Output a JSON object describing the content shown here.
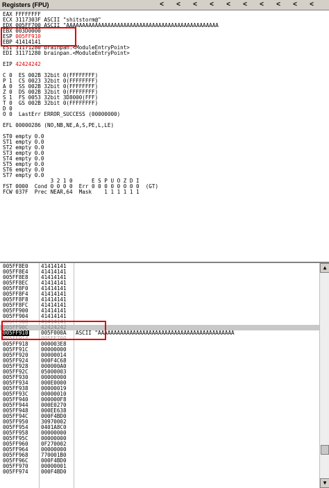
{
  "window": {
    "title": "Registers (FPU)",
    "nav_arrows": [
      "<",
      "<",
      "<",
      "<",
      "<",
      "<",
      "<",
      "<",
      "<",
      "<"
    ]
  },
  "registers": [
    {
      "text": "EAX FFFFFFFF"
    },
    {
      "text": "ECX 3117303F ASCII \"shitstorm@\""
    },
    {
      "text": "EDX 005FF700 ASCII \"AAAAAAAAAAAAAAAAAAAAAAAAAAAAAAAAAAAAAAAAAAAAAAAA"
    },
    {
      "text": "EBX 003D0000"
    },
    {
      "name": "ESP",
      "value": "005FF910"
    },
    {
      "text": "EBP 41414141"
    },
    {
      "text": "ESI 31171280 brainpan.<ModuleEntryPoint>"
    },
    {
      "text": "EDI 31171280 brainpan.<ModuleEntryPoint>"
    },
    {
      "blank": true
    },
    {
      "name": "EIP",
      "value": "42424242"
    },
    {
      "blank": true
    },
    {
      "text": "C 0  ES 002B 32bit 0(FFFFFFFF)"
    },
    {
      "text": "P 1  CS 0023 32bit 0(FFFFFFFF)"
    },
    {
      "text": "A 0  SS 002B 32bit 0(FFFFFFFF)"
    },
    {
      "text": "Z 0  DS 002B 32bit 0(FFFFFFFF)"
    },
    {
      "text": "S 1  FS 0053 32bit 3D8000(FFF)"
    },
    {
      "text": "T 0  GS 002B 32bit 0(FFFFFFFF)"
    },
    {
      "text": "D 0"
    },
    {
      "text": "O 0  LastErr ERROR_SUCCESS (00000000)"
    },
    {
      "blank": true
    },
    {
      "text": "EFL 00000286 (NO,NB,NE,A,S,PE,L,LE)"
    },
    {
      "blank": true
    },
    {
      "text": "ST0 empty 0.0"
    },
    {
      "text": "ST1 empty 0.0"
    },
    {
      "text": "ST2 empty 0.0"
    },
    {
      "text": "ST3 empty 0.0"
    },
    {
      "text": "ST4 empty 0.0"
    },
    {
      "text": "ST5 empty 0.0"
    },
    {
      "text": "ST6 empty 0.0"
    },
    {
      "text": "ST7 empty 0.0"
    },
    {
      "text": "               3 2 1 0      E S P U O Z D I"
    },
    {
      "text": "FST 0000  Cond 0 0 0 0  Err 0 0 0 0 0 0 0 0  (GT)"
    },
    {
      "text": "FCW 037F  Prec NEAR,64  Mask    1 1 1 1 1 1"
    }
  ],
  "stack": [
    {
      "addr": "005FF8E0",
      "val": "41414141"
    },
    {
      "addr": "005FF8E4",
      "val": "41414141"
    },
    {
      "addr": "005FF8E8",
      "val": "41414141"
    },
    {
      "addr": "005FF8EC",
      "val": "41414141"
    },
    {
      "addr": "005FF8F0",
      "val": "41414141"
    },
    {
      "addr": "005FF8F4",
      "val": "41414141"
    },
    {
      "addr": "005FF8F8",
      "val": "41414141"
    },
    {
      "addr": "005FF8FC",
      "val": "41414141"
    },
    {
      "addr": "005FF900",
      "val": "41414141"
    },
    {
      "addr": "005FF904",
      "val": "41414141"
    },
    {
      "addr": "005FF908",
      "val": "41414141",
      "style": "faint"
    },
    {
      "addr": "005FF90C",
      "val": "42424242",
      "style": "gray"
    },
    {
      "addr": "005FF910",
      "val": "005F000A",
      "style": "sel",
      "comment": "ASCII \"AAAAAAAAAAAAAAAAAAAAAAAAAAAAAAAAAAAAAAAAAAA"
    },
    {
      "addr": "005FF914",
      "val": "005FF700",
      "style": "faint"
    },
    {
      "addr": "005FF918",
      "val": "000003E8"
    },
    {
      "addr": "005FF91C",
      "val": "00000000"
    },
    {
      "addr": "005FF920",
      "val": "00000014"
    },
    {
      "addr": "005FF924",
      "val": "000F4C68"
    },
    {
      "addr": "005FF928",
      "val": "000000A0"
    },
    {
      "addr": "005FF92C",
      "val": "05000003"
    },
    {
      "addr": "005FF930",
      "val": "00000000"
    },
    {
      "addr": "005FF934",
      "val": "000E0000"
    },
    {
      "addr": "005FF938",
      "val": "00000019"
    },
    {
      "addr": "005FF93C",
      "val": "00000010"
    },
    {
      "addr": "005FF940",
      "val": "000000F8"
    },
    {
      "addr": "005FF944",
      "val": "000E0270"
    },
    {
      "addr": "005FF948",
      "val": "000EE638"
    },
    {
      "addr": "005FF94C",
      "val": "000F4BD0"
    },
    {
      "addr": "005FF950",
      "val": "30970002"
    },
    {
      "addr": "005FF954",
      "val": "0401A8C0"
    },
    {
      "addr": "005FF958",
      "val": "00000000"
    },
    {
      "addr": "005FF95C",
      "val": "00000000"
    },
    {
      "addr": "005FF960",
      "val": "0F270002"
    },
    {
      "addr": "005FF964",
      "val": "00000000"
    },
    {
      "addr": "005FF968",
      "val": "770001B0"
    },
    {
      "addr": "005FF96C",
      "val": "000F4BD0"
    },
    {
      "addr": "005FF970",
      "val": "00000001"
    },
    {
      "addr": "005FF974",
      "val": "000F4BD0"
    }
  ],
  "colors": {
    "highlight": "#e00000",
    "selection_bg": "#000000",
    "gray_row": "#c8c8c8"
  }
}
